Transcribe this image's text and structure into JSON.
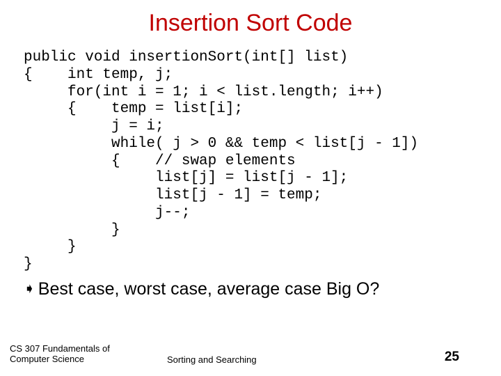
{
  "title": "Insertion Sort Code",
  "code": "public void insertionSort(int[] list)\n{    int temp, j;\n     for(int i = 1; i < list.length; i++)\n     {    temp = list[i];\n          j = i;\n          while( j > 0 && temp < list[j - 1])\n          {    // swap elements\n               list[j] = list[j - 1];\n               list[j - 1] = temp;\n               j--;\n          }\n     }\n}",
  "bullet": {
    "glyph": "➧",
    "text": "Best case, worst case, average case Big O?"
  },
  "footer": {
    "left_line1": "CS 307 Fundamentals of",
    "left_line2": "Computer Science",
    "center": "Sorting and Searching",
    "page": "25"
  }
}
